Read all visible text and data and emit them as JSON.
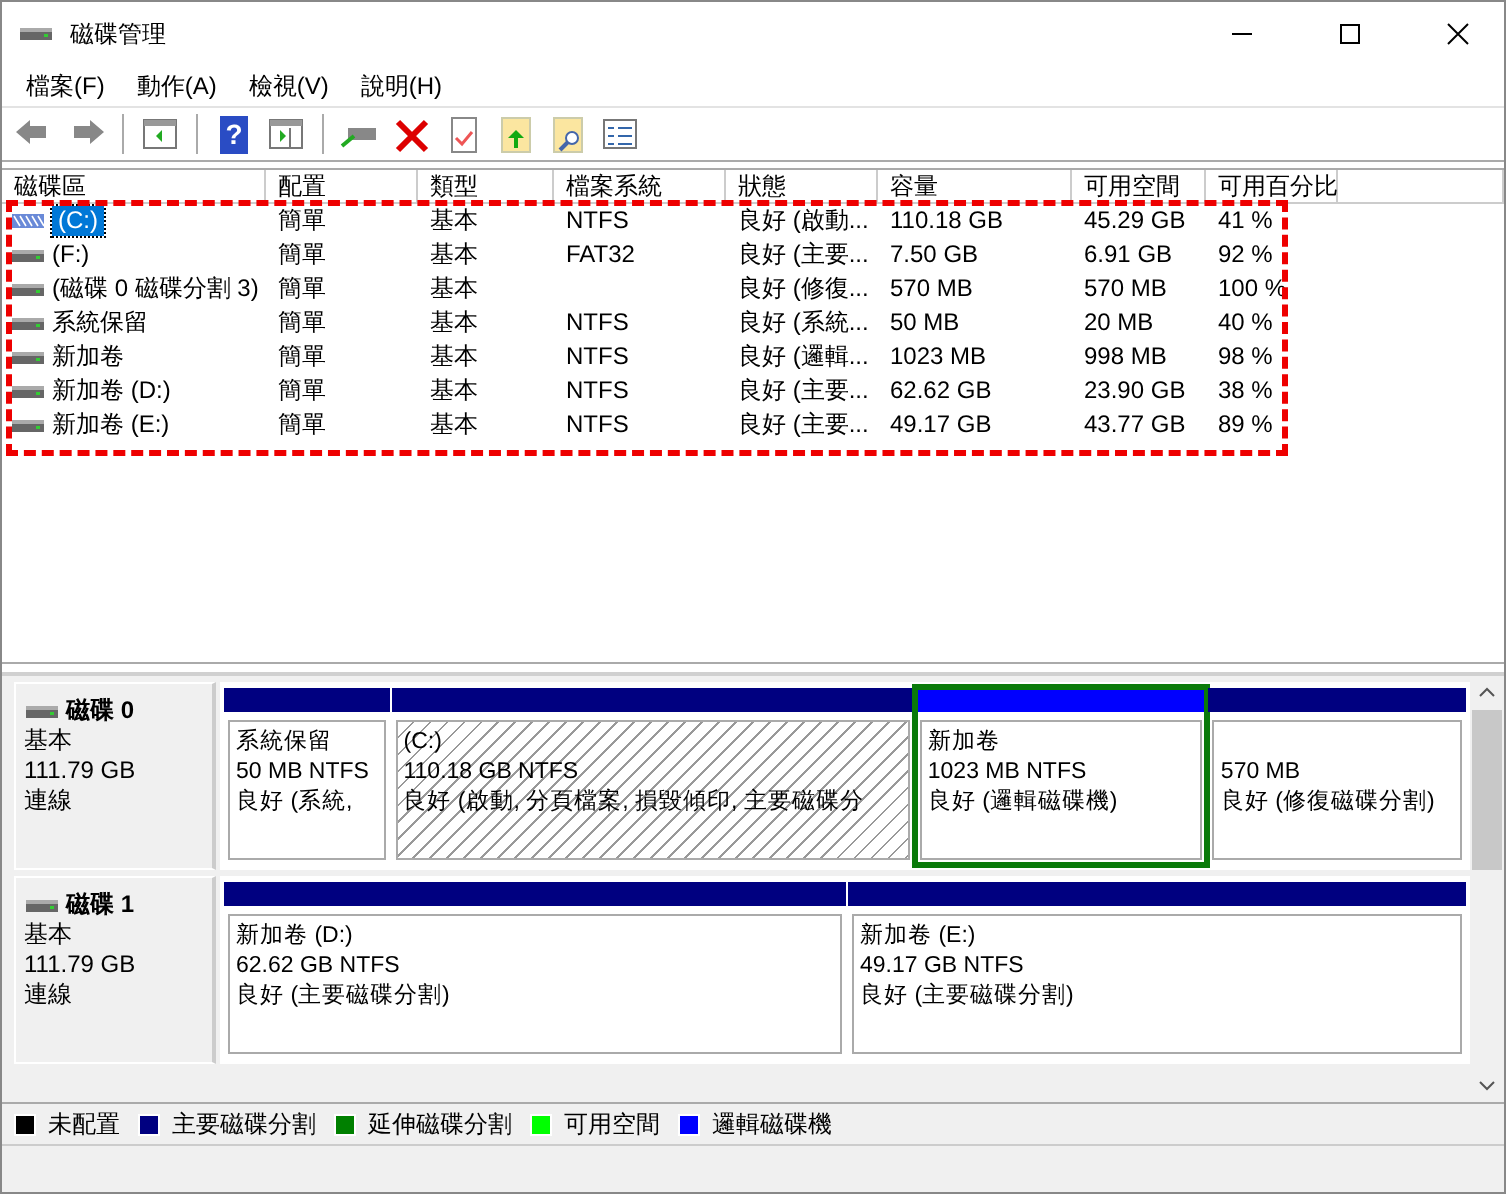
{
  "window": {
    "title": "磁碟管理"
  },
  "menu": [
    "檔案(F)",
    "動作(A)",
    "檢視(V)",
    "說明(H)"
  ],
  "toolbar": {
    "help_label": "?"
  },
  "table": {
    "columns": [
      "磁碟區",
      "配置",
      "類型",
      "檔案系統",
      "狀態",
      "容量",
      "可用空間",
      "可用百分比"
    ],
    "rows": [
      {
        "cells": [
          "(C:)",
          "簡單",
          "基本",
          "NTFS",
          "良好 (啟動...",
          "110.18 GB",
          "45.29 GB",
          "41 %"
        ],
        "selected": true
      },
      {
        "cells": [
          "(F:)",
          "簡單",
          "基本",
          "FAT32",
          "良好 (主要...",
          "7.50 GB",
          "6.91 GB",
          "92 %"
        ],
        "selected": false
      },
      {
        "cells": [
          "(磁碟 0 磁碟分割 3)",
          "簡單",
          "基本",
          "",
          "良好 (修復...",
          "570 MB",
          "570 MB",
          "100 %"
        ],
        "selected": false
      },
      {
        "cells": [
          "系統保留",
          "簡單",
          "基本",
          "NTFS",
          "良好 (系統...",
          "50 MB",
          "20 MB",
          "40 %"
        ],
        "selected": false
      },
      {
        "cells": [
          "新加卷",
          "簡單",
          "基本",
          "NTFS",
          "良好 (邏輯...",
          "1023 MB",
          "998 MB",
          "98 %"
        ],
        "selected": false
      },
      {
        "cells": [
          "新加卷 (D:)",
          "簡單",
          "基本",
          "NTFS",
          "良好 (主要...",
          "62.62 GB",
          "23.90 GB",
          "38 %"
        ],
        "selected": false
      },
      {
        "cells": [
          "新加卷 (E:)",
          "簡單",
          "基本",
          "NTFS",
          "良好 (主要...",
          "49.17 GB",
          "43.77 GB",
          "89 %"
        ],
        "selected": false
      }
    ]
  },
  "disks": [
    {
      "name": "磁碟 0",
      "type": "基本",
      "size": "111.79 GB",
      "status": "連線",
      "partitions": [
        {
          "name": "系統保留",
          "size": "50 MB NTFS",
          "status": "良好 (系統,",
          "color": "#000080",
          "selected": false,
          "extended": false
        },
        {
          "name": "(C:)",
          "size": "110.18 GB NTFS",
          "status": "良好 (啟動, 分頁檔案, 損毀傾印, 主要磁碟分",
          "color": "#000080",
          "selected": true,
          "extended": false
        },
        {
          "name": "新加卷",
          "size": "1023 MB NTFS",
          "status": "良好 (邏輯磁碟機)",
          "color": "#0000ff",
          "selected": false,
          "extended": true
        },
        {
          "size": "570 MB",
          "status": "良好 (修復磁碟分割)",
          "color": "#000080",
          "selected": false,
          "extended": false
        }
      ]
    },
    {
      "name": "磁碟 1",
      "type": "基本",
      "size": "111.79 GB",
      "status": "連線",
      "partitions": [
        {
          "name": "新加卷  (D:)",
          "size": "62.62 GB NTFS",
          "status": "良好 (主要磁碟分割)",
          "color": "#000080",
          "selected": false,
          "extended": false
        },
        {
          "name": "新加卷  (E:)",
          "size": "49.17 GB NTFS",
          "status": "良好 (主要磁碟分割)",
          "color": "#000080",
          "selected": false,
          "extended": false
        }
      ]
    }
  ],
  "legend": [
    {
      "label": "未配置",
      "color": "#000000"
    },
    {
      "label": "主要磁碟分割",
      "color": "#000080"
    },
    {
      "label": "延伸磁碟分割",
      "color": "#008000"
    },
    {
      "label": "可用空間",
      "color": "#00ff00"
    },
    {
      "label": "邏輯磁碟機",
      "color": "#0000ff"
    }
  ]
}
